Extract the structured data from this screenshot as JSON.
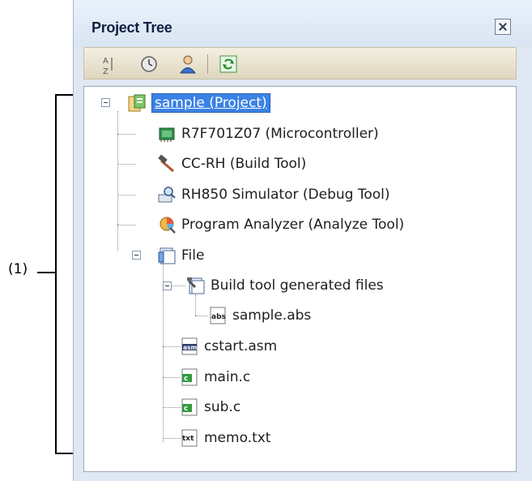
{
  "annotation": {
    "label": "(1)"
  },
  "panel": {
    "title": "Project Tree",
    "close_icon": "close-icon",
    "toolbar": [
      {
        "name": "sort-icon"
      },
      {
        "name": "clock-icon"
      },
      {
        "name": "user-icon"
      },
      {
        "name": "refresh-icon"
      }
    ]
  },
  "tree": {
    "nodes": [
      {
        "label": "sample (Project)",
        "icon": "project-icon",
        "selected": true
      },
      {
        "label": "R7F701Z07 (Microcontroller)",
        "icon": "chip-icon"
      },
      {
        "label": "CC-RH (Build Tool)",
        "icon": "hammer-icon"
      },
      {
        "label": "RH850 Simulator (Debug Tool)",
        "icon": "debug-icon"
      },
      {
        "label": "Program Analyzer (Analyze Tool)",
        "icon": "analyzer-icon"
      },
      {
        "label": "File",
        "icon": "folder-icon"
      },
      {
        "label": "Build tool generated files",
        "icon": "generated-folder-icon"
      },
      {
        "label": "sample.abs",
        "icon": "abs-file-icon",
        "badge": "abs"
      },
      {
        "label": "cstart.asm",
        "icon": "asm-file-icon",
        "badge": "asm"
      },
      {
        "label": "main.c",
        "icon": "c-file-icon",
        "badge": "c"
      },
      {
        "label": "sub.c",
        "icon": "c-file-icon",
        "badge": "c"
      },
      {
        "label": "memo.txt",
        "icon": "txt-file-icon",
        "badge": "txt"
      }
    ]
  },
  "colors": {
    "selection": "#3b82e6",
    "panel_bg": "#dfe8f3",
    "toolbar_bg": "#e8e1cc"
  }
}
